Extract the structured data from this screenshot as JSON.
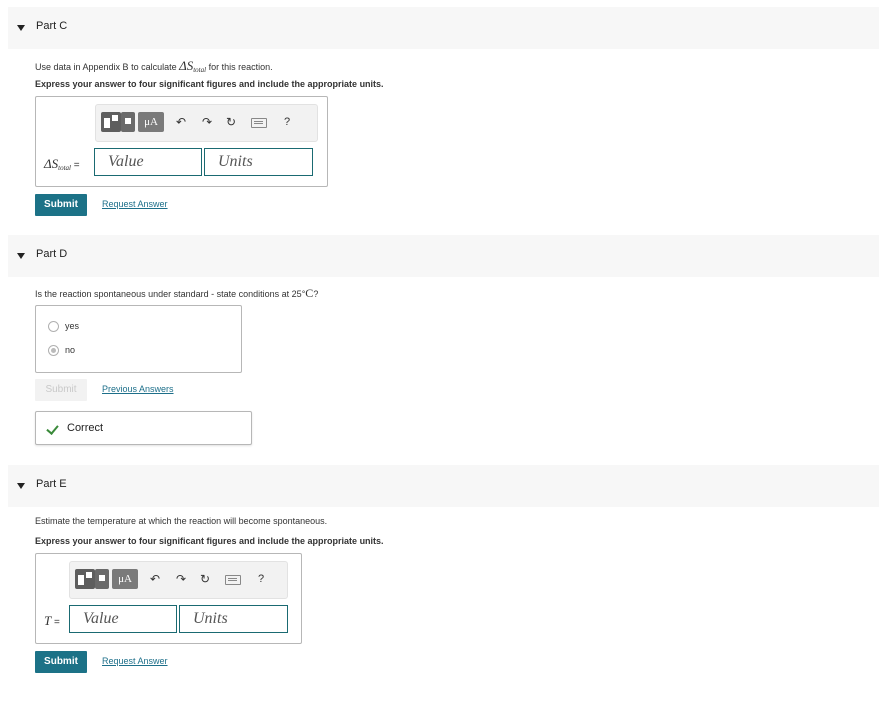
{
  "partC": {
    "title": "Part C",
    "instruction_pre": "Use data in Appendix B to calculate ",
    "instruction_math": "ΔS",
    "instruction_sub": "total",
    "instruction_post": " for this reaction.",
    "express": "Express your answer to four significant figures and include the appropriate units.",
    "answer_label": "ΔS",
    "answer_label_sub": "total",
    "answer_equals": " =",
    "value_placeholder": "Value",
    "units_placeholder": "Units",
    "submit_label": "Submit",
    "request_label": "Request Answer"
  },
  "partD": {
    "title": "Part D",
    "question_pre": "Is the reaction spontaneous under standard - state conditions at 25",
    "question_deg": "°",
    "question_unit": "C",
    "question_post": "?",
    "options": [
      "yes",
      "no"
    ],
    "selected": "no",
    "submit_label": "Submit",
    "previous_label": "Previous Answers",
    "correct_label": "Correct"
  },
  "partE": {
    "title": "Part E",
    "instruction": "Estimate the temperature at which the reaction will become spontaneous.",
    "express": "Express your answer to four significant figures and include the appropriate units.",
    "answer_label": "T",
    "answer_equals": " =",
    "value_placeholder": "Value",
    "units_placeholder": "Units",
    "submit_label": "Submit",
    "request_label": "Request Answer"
  },
  "toolbar": {
    "mu_label": "μA",
    "help_label": "?",
    "icons": [
      "templates-icon",
      "units-icon",
      "undo-icon",
      "redo-icon",
      "reset-icon",
      "keyboard-icon",
      "help-icon"
    ]
  },
  "colors": {
    "submit": "#1c7287",
    "link": "#1d6f8a",
    "field_border": "#1a6a72",
    "check": "#3a8a3a"
  }
}
